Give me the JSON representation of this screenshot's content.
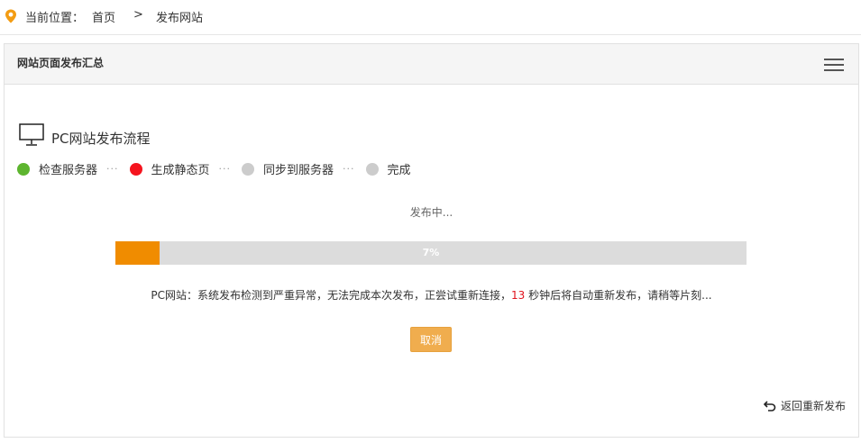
{
  "breadcrumb": {
    "location_label": "当前位置：",
    "home": "首页",
    "separator": ">",
    "current": "发布网站"
  },
  "panel": {
    "title": "网站页面发布汇总"
  },
  "flow": {
    "title": "PC网站发布流程",
    "steps": [
      {
        "label": "检查服务器",
        "color": "#5db52f"
      },
      {
        "label": "生成静态页",
        "color": "#f5141e"
      },
      {
        "label": "同步到服务器",
        "color": "#cccccc"
      },
      {
        "label": "完成",
        "color": "#cccccc"
      }
    ],
    "separator": "···"
  },
  "status": "发布中...",
  "progress": {
    "percent": 7,
    "label": "7%",
    "color": "#f08c00"
  },
  "message": {
    "prefix": "PC网站：系统发布检测到严重异常，无法完成本次发布，正尝试重新连接，",
    "countdown": "13",
    "suffix": " 秒钟后将自动重新发布，请稍等片刻..."
  },
  "buttons": {
    "cancel": "取消",
    "back": "返回重新发布"
  },
  "icons": {
    "location": "location-pin-icon",
    "menu": "hamburger-menu-icon",
    "monitor": "monitor-icon",
    "back": "return-arrow-icon"
  }
}
